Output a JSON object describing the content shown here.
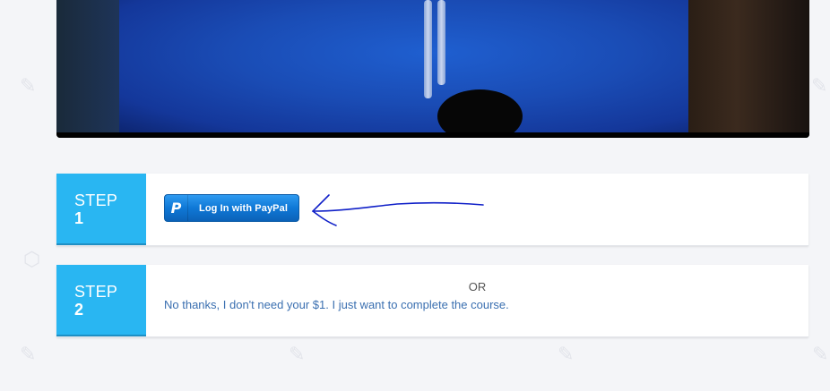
{
  "video": {
    "description_icon": "video-frame"
  },
  "steps": [
    {
      "word": "STEP",
      "number": "1",
      "paypal_button": {
        "logo": "P",
        "label": "Log In with PayPal"
      }
    },
    {
      "word": "STEP",
      "number": "2",
      "or_text": "OR",
      "link_text": "No thanks, I don't need your $1. I just want to complete the course."
    }
  ],
  "colors": {
    "step_badge": "#29b6f2",
    "paypal_blue": "#0f78d6",
    "link": "#3a6fb0",
    "annotation_arrow": "#1020c8",
    "page_bg": "#f4f5f8"
  }
}
